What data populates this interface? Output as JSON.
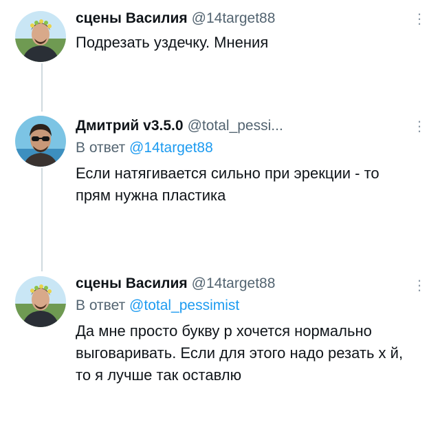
{
  "tweets": [
    {
      "name": "сцены Василия",
      "handle": "@14target88",
      "reply_prefix": "",
      "reply_to": "",
      "text": "Подрезать уздечку. Мнения",
      "avatar": "avatar-man-with-flower-crown"
    },
    {
      "name": "Дмитрий v3.5.0",
      "handle": "@total_pessi...",
      "reply_prefix": "В ответ",
      "reply_to": "@14target88",
      "text": "Если натягивается сильно при эрекции - то прям нужна пластика",
      "avatar": "avatar-man-with-sunglasses"
    },
    {
      "name": "сцены Василия",
      "handle": "@14target88",
      "reply_prefix": "В ответ",
      "reply_to": "@total_pessimist",
      "text": "Да мне просто букву р хочется нормально выговаривать. Если для этого надо резать х  й, то я лучше так оставлю",
      "avatar": "avatar-man-with-flower-crown"
    }
  ],
  "colors": {
    "text": "#0f1419",
    "muted": "#536471",
    "link": "#1d9bf0",
    "thread_line": "#cfd9de"
  },
  "icons": {
    "more": "more-vertical-icon"
  }
}
